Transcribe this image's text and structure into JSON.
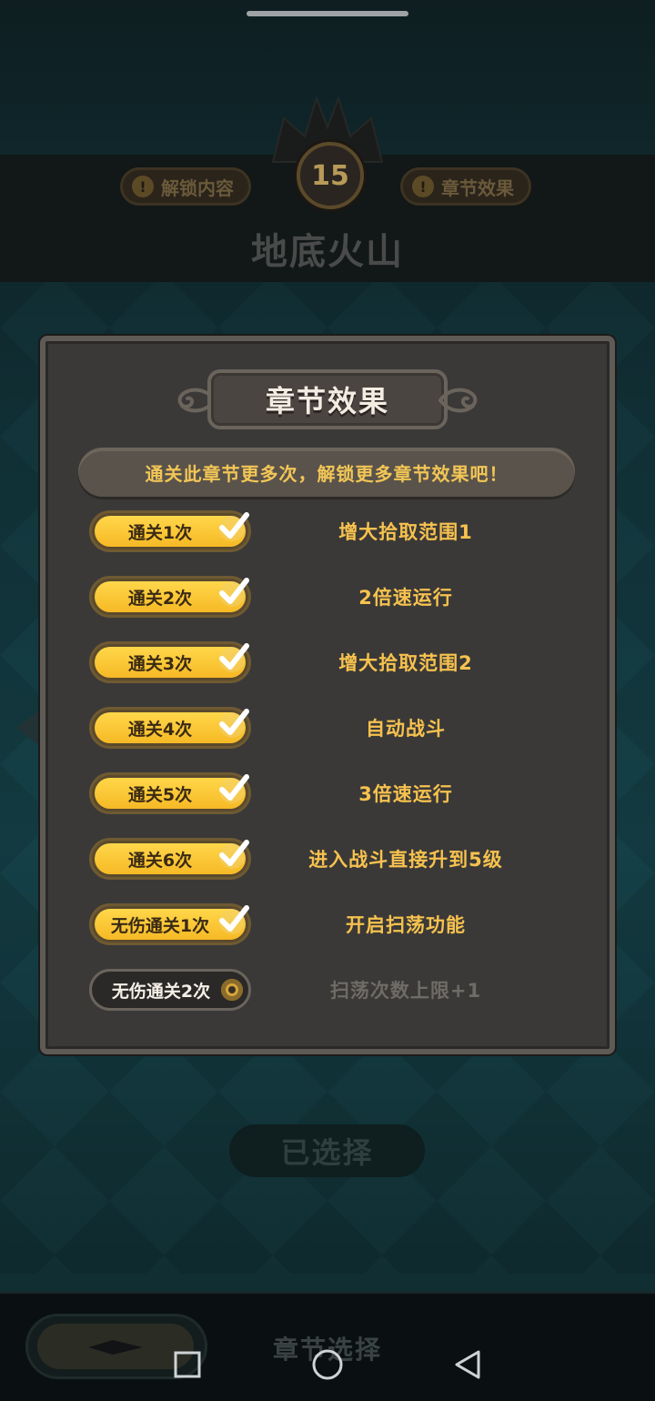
{
  "background": {
    "level_number": "15",
    "unlock_content_label": "解锁内容",
    "chapter_effect_label": "章节效果",
    "warn_glyph": "!",
    "chapter_title": "地底火山",
    "selected_button": "已选择",
    "bottom_tab_label": "章节选择"
  },
  "modal": {
    "title": "章节效果",
    "notice": "通关此章节更多次，解锁更多章节效果吧！",
    "rows": [
      {
        "condition": "通关1次",
        "effect": "增大拾取范围1",
        "unlocked": true
      },
      {
        "condition": "通关2次",
        "effect": "2倍速运行",
        "unlocked": true
      },
      {
        "condition": "通关3次",
        "effect": "增大拾取范围2",
        "unlocked": true
      },
      {
        "condition": "通关4次",
        "effect": "自动战斗",
        "unlocked": true
      },
      {
        "condition": "通关5次",
        "effect": "3倍速运行",
        "unlocked": true
      },
      {
        "condition": "通关6次",
        "effect": "进入战斗直接升到5级",
        "unlocked": true
      },
      {
        "condition": "无伤通关1次",
        "effect": "开启扫荡功能",
        "unlocked": true
      },
      {
        "condition": "无伤通关2次",
        "effect": "扫荡次数上限+1",
        "unlocked": false
      }
    ]
  },
  "icons": {
    "check": "checkmark-icon",
    "locked": "lock-dot-icon",
    "nav": [
      "square-icon",
      "circle-icon",
      "triangle-back-icon"
    ]
  },
  "colors": {
    "accent_gold": "#f7c24e",
    "pill_yellow": "#ffd74a",
    "modal_bg": "#3a3938",
    "locked_text": "#6f6b66"
  }
}
